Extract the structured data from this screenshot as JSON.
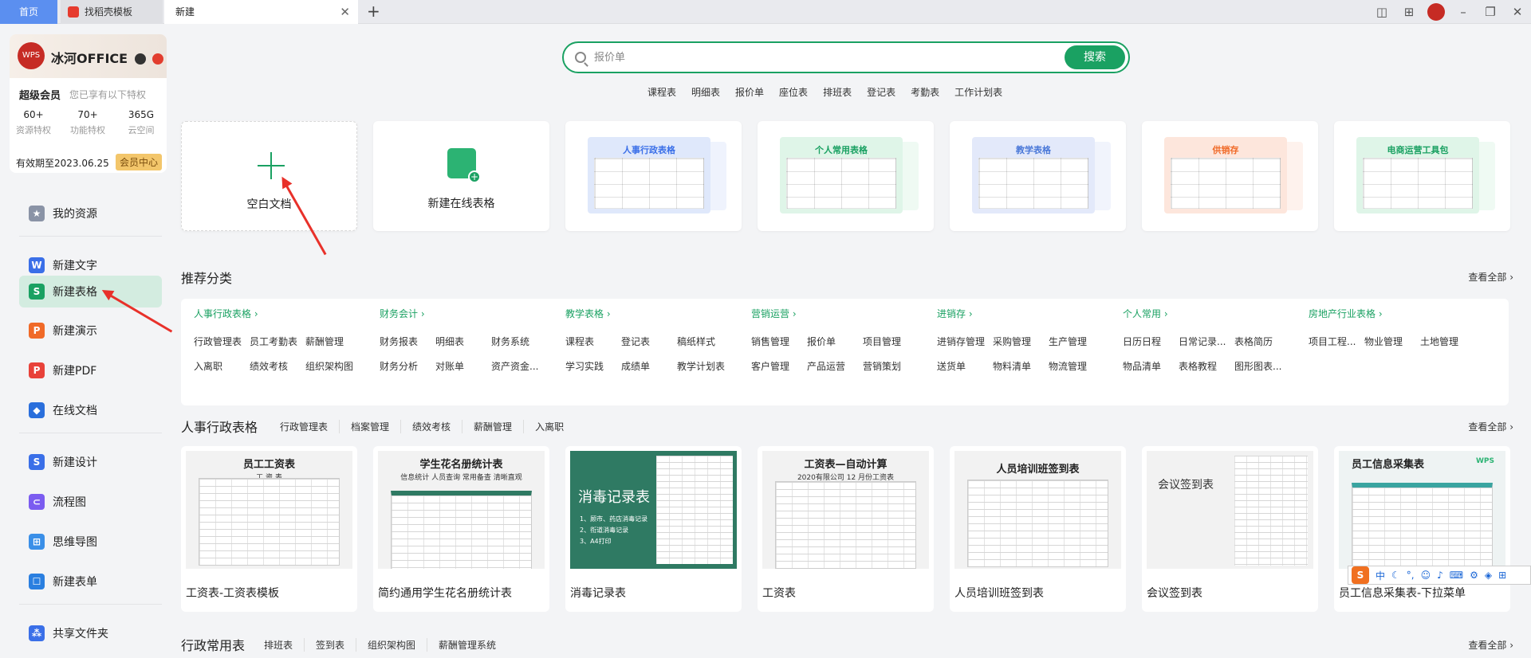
{
  "tabs": {
    "home": "首页",
    "templates": "找稻壳模板",
    "current": "新建"
  },
  "sidebar": {
    "brand": "冰河OFFICE",
    "vip_title": "超级会员",
    "vip_desc": "您已享有以下特权",
    "stats": [
      {
        "value": "60+",
        "label": "资源特权"
      },
      {
        "value": "70+",
        "label": "功能特权"
      },
      {
        "value": "365G",
        "label": "云空间"
      }
    ],
    "expire": "有效期至2023.06.25",
    "member_center": "会员中心",
    "items": [
      {
        "label": "我的资源",
        "color": "#8a93a6",
        "glyph": "★"
      },
      {
        "label": "新建文字",
        "color": "#3a6fe8",
        "glyph": "W"
      },
      {
        "label": "新建表格",
        "color": "#1aa162",
        "glyph": "S"
      },
      {
        "label": "新建演示",
        "color": "#f06a28",
        "glyph": "P"
      },
      {
        "label": "新建PDF",
        "color": "#e8423a",
        "glyph": "P"
      },
      {
        "label": "在线文档",
        "color": "#2a6fdc",
        "glyph": "◆"
      },
      {
        "label": "新建设计",
        "color": "#3a6fe8",
        "glyph": "S"
      },
      {
        "label": "流程图",
        "color": "#7b5cf0",
        "glyph": "⊂"
      },
      {
        "label": "思维导图",
        "color": "#3a8fe8",
        "glyph": "⊞"
      },
      {
        "label": "新建表单",
        "color": "#2a7fe0",
        "glyph": "☐"
      },
      {
        "label": "共享文件夹",
        "color": "#3a6fe8",
        "glyph": "⁂"
      }
    ]
  },
  "search": {
    "placeholder": "报价单",
    "button": "搜索"
  },
  "hotwords": [
    "课程表",
    "明细表",
    "报价单",
    "座位表",
    "排班表",
    "登记表",
    "考勤表",
    "工作计划表"
  ],
  "quick": {
    "blank": "空白文档",
    "online": "新建在线表格",
    "templates": [
      {
        "title": "人事行政表格",
        "color": "#dfe8fb",
        "accent": "#3a6fe8"
      },
      {
        "title": "个人常用表格",
        "color": "#dff5e8",
        "accent": "#1aa162"
      },
      {
        "title": "教学表格",
        "color": "#e3e9fa",
        "accent": "#4a78d8"
      },
      {
        "title": "供销存",
        "color": "#fde6dc",
        "accent": "#f06a28"
      },
      {
        "title": "电商运营工具包",
        "color": "#dff5e8",
        "accent": "#1aa162"
      }
    ]
  },
  "recommend": {
    "title": "推荐分类",
    "see_all": "查看全部 ›",
    "categories": [
      {
        "name": "人事行政表格 ›",
        "items": [
          "行政管理表",
          "员工考勤表",
          "薪酬管理",
          "入离职",
          "绩效考核",
          "组织架构图"
        ]
      },
      {
        "name": "财务会计 ›",
        "items": [
          "财务报表",
          "明细表",
          "财务系统",
          "财务分析",
          "对账单",
          "资产资金..."
        ]
      },
      {
        "name": "教学表格 ›",
        "items": [
          "课程表",
          "登记表",
          "稿纸样式",
          "学习实践",
          "成绩单",
          "教学计划表"
        ]
      },
      {
        "name": "营销运营 ›",
        "items": [
          "销售管理",
          "报价单",
          "项目管理",
          "客户管理",
          "产品运营",
          "营销策划"
        ]
      },
      {
        "name": "进销存 ›",
        "items": [
          "进销存管理",
          "采购管理",
          "生产管理",
          "送货单",
          "物料清单",
          "物流管理"
        ]
      },
      {
        "name": "个人常用 ›",
        "items": [
          "日历日程",
          "日常记录...",
          "表格简历",
          "物品清单",
          "表格教程",
          "图形图表..."
        ]
      },
      {
        "name": "房地产行业表格 ›",
        "items": [
          "项目工程...",
          "物业管理",
          "土地管理"
        ]
      }
    ]
  },
  "hr": {
    "title": "人事行政表格",
    "see_all": "查看全部 ›",
    "subtabs": [
      "行政管理表",
      "档案管理",
      "绩效考核",
      "薪酬管理",
      "入离职"
    ],
    "cards": [
      {
        "label": "工资表-工资表模板",
        "head": "员工工资表",
        "sub": "工 资 表"
      },
      {
        "label": "简约通用学生花名册统计表",
        "head": "学生花名册统计表",
        "sub": "信息统计 人员查询 常用备查 清晰直观"
      },
      {
        "label": "消毒记录表",
        "head": "消毒记录表",
        "lines": [
          "1、顾市、药店消毒记录",
          "2、衔道消毒记录",
          "3、A4打印"
        ]
      },
      {
        "label": "工资表",
        "head": "工资表—自动计算",
        "sub": "2020有限公司  12  月份工资表"
      },
      {
        "label": "人员培训班签到表",
        "head": "人员培训班签到表",
        "sub": ""
      },
      {
        "label": "会议签到表",
        "head": "会议签到表",
        "sub": ""
      },
      {
        "label": "员工信息采集表-下拉菜单",
        "head": "员工信息采集表",
        "sub": "WPS"
      }
    ]
  },
  "admin": {
    "title": "行政常用表",
    "see_all": "查看全部 ›",
    "subtabs": [
      "排班表",
      "签到表",
      "组织架构图",
      "薪酬管理系统"
    ]
  },
  "ime": {
    "logo": "S",
    "lang": "中"
  }
}
